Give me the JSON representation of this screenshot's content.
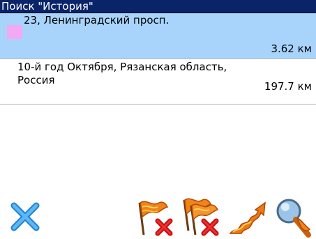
{
  "window": {
    "title": "Поиск \"История\""
  },
  "results": [
    {
      "name": "23, Ленинградский просп.",
      "distance": "3.62 км",
      "selected": true
    },
    {
      "name_line1": "10-й год  Октября, Рязанская область,",
      "name_line2": "Россия",
      "distance": "197.7 км",
      "selected": false
    }
  ],
  "toolbar": {
    "buttons": [
      {
        "icon": "close-icon"
      },
      {
        "icon": "flag-delete-icon"
      },
      {
        "icon": "flags-delete-all-icon"
      },
      {
        "icon": "route-icon"
      },
      {
        "icon": "search-magnifier-icon"
      }
    ]
  },
  "colors": {
    "title_bg": "#0a246a",
    "selected_row": "#a8d4fc",
    "poi_icon": "#f3a8f3",
    "close_x": "#3a9ee4",
    "delete_x": "#e01818",
    "flag": "#f07a10"
  }
}
